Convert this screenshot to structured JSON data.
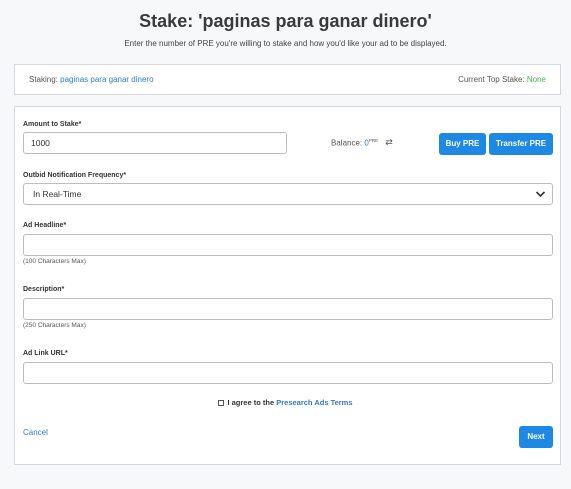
{
  "page": {
    "title": "Stake: 'paginas para ganar dinero'",
    "subtitle": "Enter the number of PRE you're willing to stake and how you'd like your ad to be displayed."
  },
  "staking": {
    "label": "Staking:",
    "keyword": "paginas para ganar dinero",
    "top_stake_label": "Current Top Stake:",
    "top_stake_value": "None"
  },
  "form": {
    "amount_label": "Amount to Stake*",
    "amount_value": "1000",
    "balance_label": "Balance:",
    "balance_value": "0",
    "balance_unit": "PRE",
    "buy_label": "Buy PRE",
    "transfer_label": "Transfer PRE",
    "frequency_label": "Outbid Notification Frequency*",
    "frequency_value": "In Real-Time",
    "headline_label": "Ad Headline*",
    "headline_value": "",
    "headline_hint": "(100 Characters Max)",
    "description_label": "Description*",
    "description_value": "",
    "description_hint": "(250 Characters Max)",
    "link_label": "Ad Link URL*",
    "link_value": "",
    "agree_text": "I agree to the",
    "agree_link": "Presearch Ads Terms",
    "cancel_label": "Cancel",
    "next_label": "Next"
  },
  "colors": {
    "accent": "#1e88e5",
    "link": "#2f7cc6",
    "success": "#4cb04c"
  },
  "icons": [
    "refresh-icon",
    "chevron-down-icon",
    "checkbox-icon"
  ]
}
